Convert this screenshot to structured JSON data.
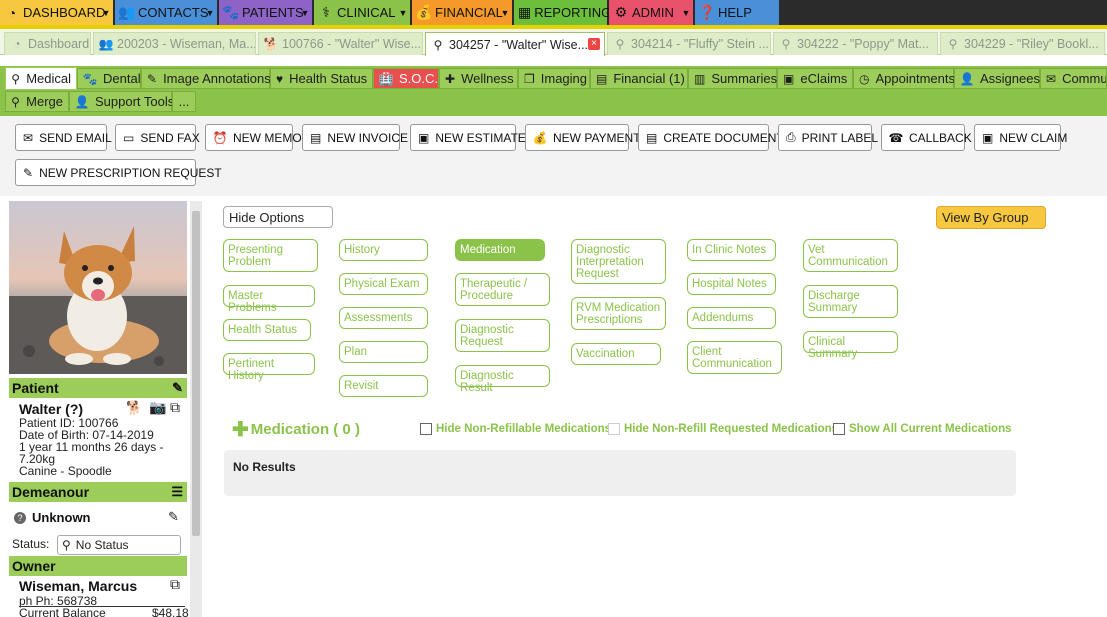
{
  "topnav": {
    "items": [
      {
        "label": "DASHBOARD",
        "icon": "dashboard-icon",
        "color": "#f7c83f"
      },
      {
        "label": "CONTACTS",
        "icon": "contacts-icon",
        "color": "#4a90d9"
      },
      {
        "label": "PATIENTS",
        "icon": "paw-icon",
        "color": "#8e63c7"
      },
      {
        "label": "CLINICAL",
        "icon": "caduceus-icon",
        "color": "#8bc34a"
      },
      {
        "label": "FINANCIAL",
        "icon": "money-bag-icon",
        "color": "#f59a2a"
      },
      {
        "label": "REPORTING",
        "icon": "chart-icon",
        "color": "#6bbf3a"
      },
      {
        "label": "ADMIN",
        "icon": "gear-icon",
        "color": "#e8536b"
      },
      {
        "label": "HELP",
        "icon": "help-icon",
        "color": "#4a90d9"
      }
    ]
  },
  "record_tabs": [
    {
      "label": "Dashboard",
      "icon": "dashboard-icon"
    },
    {
      "label": "200203 - Wiseman, Ma...",
      "icon": "contacts-icon"
    },
    {
      "label": "100766 - \"Walter\" Wise...",
      "icon": "dog-icon"
    },
    {
      "label": "304257 - \"Walter\" Wise...",
      "icon": "stethoscope-icon",
      "active": true
    },
    {
      "label": "304214 - \"Fluffy\" Stein ...",
      "icon": "stethoscope-icon"
    },
    {
      "label": "304222 - \"Poppy\" Mat...",
      "icon": "stethoscope-icon"
    },
    {
      "label": "304229 - \"Riley\" Bookl...",
      "icon": "stethoscope-icon"
    }
  ],
  "section_tabs": {
    "row1": [
      "Medical",
      "Dental",
      "Image Annotations",
      "Health Status",
      "S.O.C.",
      "Wellness",
      "Imaging",
      "Financial (1)",
      "Summaries",
      "eClaims",
      "Appointments",
      "Assignees",
      "Commu"
    ],
    "row2": [
      "Merge",
      "Support Tools",
      "..."
    ]
  },
  "actions": [
    "SEND EMAIL",
    "SEND FAX",
    "NEW MEMO",
    "NEW INVOICE",
    "NEW ESTIMATE",
    "NEW PAYMENT",
    "CREATE DOCUMENT",
    "PRINT LABEL",
    "CALLBACK",
    "NEW CLAIM",
    "NEW PRESCRIPTION REQUEST"
  ],
  "patient": {
    "header": "Patient",
    "name": "Walter (?)",
    "id": "Patient ID: 100766",
    "dob": "Date of Birth: 07-14-2019",
    "age": "1 year 11 months 26 days -",
    "weight": "7.20kg",
    "species": "Canine - Spoodle"
  },
  "demeanour": {
    "header": "Demeanour",
    "value": "Unknown",
    "status_label": "Status:",
    "status_value": "No Status"
  },
  "owner": {
    "header": "Owner",
    "name": "Wiseman, Marcus",
    "phone": "ph Ph: 568738",
    "balance_label": "Current Balance",
    "balance": "$48.18"
  },
  "main": {
    "hide_options": "Hide Options",
    "view_by_group": "View By Group",
    "chips": {
      "col1": [
        "Presenting Problem",
        "Master Problems",
        "Health Status",
        "Pertinent History"
      ],
      "col2": [
        "History",
        "Physical Exam",
        "Assessments",
        "Plan",
        "Revisit"
      ],
      "col3": [
        "Medication",
        "Therapeutic / Procedure",
        "Diagnostic Request",
        "Diagnostic Result"
      ],
      "col4": [
        "Diagnostic Interpretation Request",
        "RVM Medication Prescriptions",
        "Vaccination"
      ],
      "col5": [
        "In Clinic Notes",
        "Hospital Notes",
        "Addendums",
        "Client Communication"
      ],
      "col6": [
        "Vet Communication",
        "Discharge Summary",
        "Clinical Summary"
      ]
    },
    "medication_title": "Medication ( 0 )",
    "checkboxes": [
      "Hide Non-Refillable Medications",
      "Hide Non-Refill Requested Medications",
      "Show All Current Medications"
    ],
    "no_results": "No Results"
  }
}
